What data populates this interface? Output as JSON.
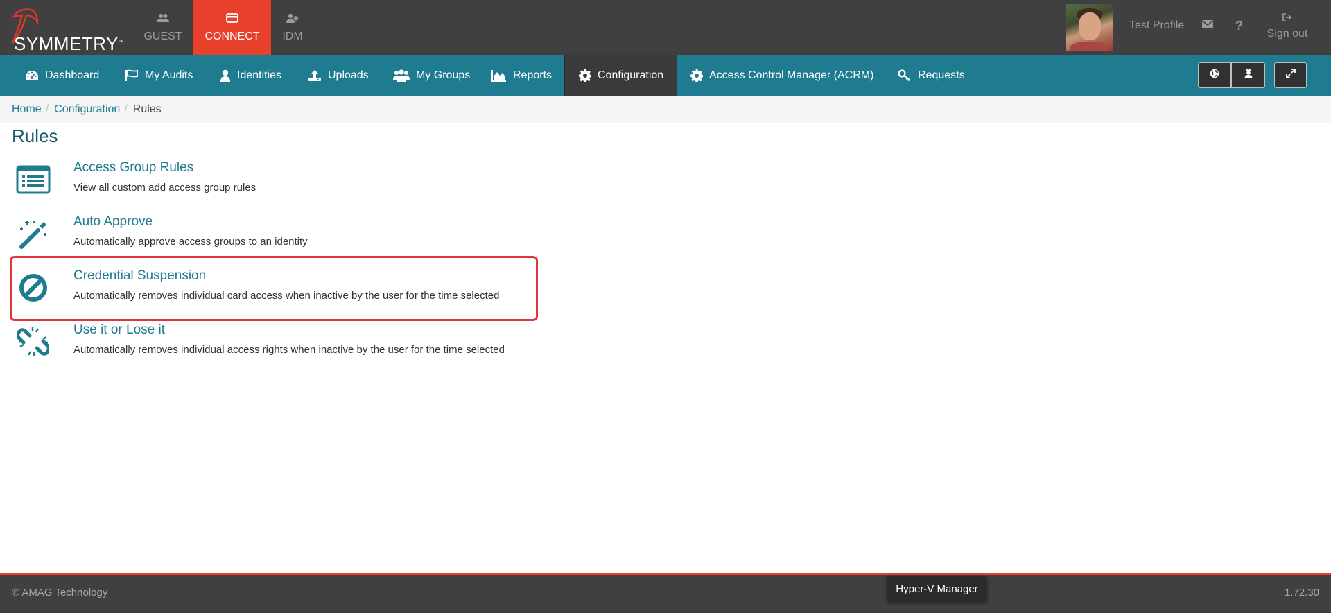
{
  "brand": {
    "logo_text": "SYMMETRY",
    "trademark": "™"
  },
  "app_tabs": [
    {
      "label": "GUEST",
      "icon": "users-icon",
      "active": false
    },
    {
      "label": "CONNECT",
      "icon": "credit-card-icon",
      "active": true
    },
    {
      "label": "IDM",
      "icon": "user-plus-icon",
      "active": false
    }
  ],
  "header": {
    "profile_name": "Test Profile",
    "signout_label": "Sign out"
  },
  "nav": {
    "items": [
      {
        "label": "Dashboard",
        "icon": "dashboard-icon"
      },
      {
        "label": "My Audits",
        "icon": "flag-icon"
      },
      {
        "label": "Identities",
        "icon": "user-icon"
      },
      {
        "label": "Uploads",
        "icon": "upload-icon"
      },
      {
        "label": "My Groups",
        "icon": "group-icon"
      },
      {
        "label": "Reports",
        "icon": "area-chart-icon"
      },
      {
        "label": "Configuration",
        "icon": "gear-icon",
        "active": true
      },
      {
        "label": "Access Control Manager (ACRM)",
        "icon": "gear-icon"
      },
      {
        "label": "Requests",
        "icon": "key-icon"
      }
    ]
  },
  "breadcrumb": {
    "home": "Home",
    "configuration": "Configuration",
    "current": "Rules",
    "separator": "/"
  },
  "page": {
    "title": "Rules"
  },
  "rules": [
    {
      "title": "Access Group Rules",
      "description": "View all custom add access group rules",
      "icon": "list-icon"
    },
    {
      "title": "Auto Approve",
      "description": "Automatically approve access groups to an identity",
      "icon": "magic-wand-icon"
    },
    {
      "title": "Credential Suspension",
      "description": "Automatically removes individual card access when inactive by the user for the time selected",
      "icon": "ban-icon",
      "highlighted": true
    },
    {
      "title": "Use it or Lose it",
      "description": "Automatically removes individual access rights when inactive by the user for the time selected",
      "icon": "broken-link-icon"
    }
  ],
  "footer": {
    "copyright": "© AMAG Technology",
    "version": "1.72.30"
  },
  "tooltip": {
    "text": "Hyper-V Manager"
  },
  "colors": {
    "header_bg": "#404040",
    "nav_bg": "#1f7b8f",
    "accent_red": "#e8402a",
    "link": "#1f7b8f",
    "highlight_border": "#e0333c"
  }
}
